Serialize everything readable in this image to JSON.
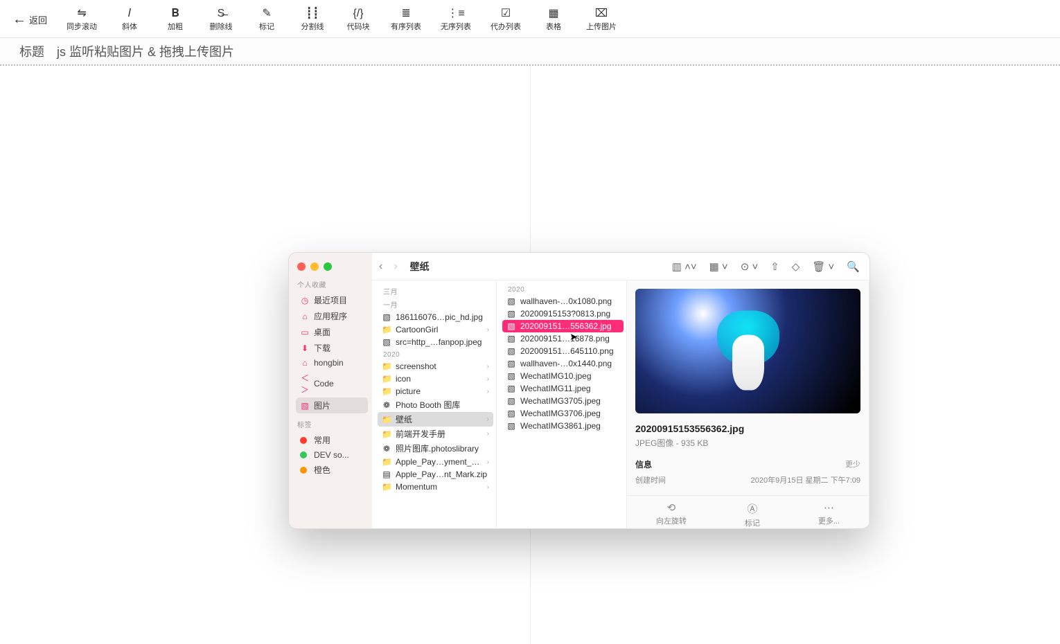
{
  "toolbar": {
    "back": "返回",
    "items": [
      {
        "icon": "⇋",
        "label": "同步滚动"
      },
      {
        "icon": "𝐼",
        "label": "斜体"
      },
      {
        "icon": "𝐁",
        "label": "加粗"
      },
      {
        "icon": "S̶",
        "label": "删除线"
      },
      {
        "icon": "✎",
        "label": "标记"
      },
      {
        "icon": "┋┋",
        "label": "分割线"
      },
      {
        "icon": "{/}",
        "label": "代码块"
      },
      {
        "icon": "≣",
        "label": "有序列表"
      },
      {
        "icon": "⋮≡",
        "label": "无序列表"
      },
      {
        "icon": "☑",
        "label": "代办列表"
      },
      {
        "icon": "▦",
        "label": "表格"
      },
      {
        "icon": "⌧",
        "label": "上传图片"
      }
    ]
  },
  "title": {
    "label": "标题",
    "value": "js 监听粘贴图片 & 拖拽上传图片"
  },
  "finder": {
    "title": "壁纸",
    "sections": {
      "fav": "个人收藏",
      "tags": "标签"
    },
    "sidebar": [
      {
        "icon": "◷",
        "label": "最近项目",
        "cls": "pink"
      },
      {
        "icon": "⌂",
        "label": "应用程序",
        "cls": "pink"
      },
      {
        "icon": "▭",
        "label": "桌面",
        "cls": "pink"
      },
      {
        "icon": "⬇",
        "label": "下载",
        "cls": "pink"
      },
      {
        "icon": "⌂",
        "label": "hongbin",
        "cls": "pink"
      },
      {
        "icon": "＜＞",
        "label": "Code",
        "cls": "pink"
      },
      {
        "icon": "▧",
        "label": "图片",
        "cls": "pink",
        "active": true
      }
    ],
    "tags": [
      {
        "color": "red",
        "label": "常用"
      },
      {
        "color": "green",
        "label": "DEV so..."
      },
      {
        "color": "orange",
        "label": "橙色"
      }
    ],
    "col1": {
      "groups": [
        {
          "title": "三月",
          "items": []
        },
        {
          "title": "一月",
          "items": [
            {
              "icon": "▧",
              "label": "186116076…pic_hd.jpg"
            },
            {
              "icon": "📁",
              "label": "CartoonGirl",
              "folder": true,
              "caret": true
            },
            {
              "icon": "▧",
              "label": "src=http_…fanpop.jpeg"
            }
          ]
        },
        {
          "title": "2020",
          "items": [
            {
              "icon": "📁",
              "label": "screenshot",
              "folder": true,
              "caret": true
            },
            {
              "icon": "📁",
              "label": "icon",
              "folder": true,
              "caret": true
            },
            {
              "icon": "📁",
              "label": "picture",
              "folder": true,
              "caret": true
            },
            {
              "icon": "❁",
              "label": "Photo Booth 图库",
              "iconcls": "red"
            },
            {
              "icon": "📁",
              "label": "壁纸",
              "folder": true,
              "caret": true,
              "selected": true
            },
            {
              "icon": "📁",
              "label": "前端开发手册",
              "folder": true,
              "caret": true
            },
            {
              "icon": "❁",
              "label": "照片图库.photoslibrary",
              "iconcls": "red"
            },
            {
              "icon": "📁",
              "label": "Apple_Pay…yment_Mark",
              "folder": true,
              "caret": true
            },
            {
              "icon": "▤",
              "label": "Apple_Pay…nt_Mark.zip"
            },
            {
              "icon": "📁",
              "label": "Momentum",
              "folder": true,
              "caret": true
            }
          ]
        }
      ]
    },
    "col2": {
      "title": "2020",
      "items": [
        {
          "label": "wallhaven-…0x1080.png"
        },
        {
          "label": "20200915153?0813.png"
        },
        {
          "label": "202009151…556362.jpg",
          "selected": true
        },
        {
          "label": "202009151…16878.png"
        },
        {
          "label": "202009151…645110.png"
        },
        {
          "label": "wallhaven-…0x1440.png"
        },
        {
          "label": "WechatIMG10.jpeg"
        },
        {
          "label": "WechatIMG11.jpeg"
        },
        {
          "label": "WechatIMG3705.jpeg"
        },
        {
          "label": "WechatIMG3706.jpeg"
        },
        {
          "label": "WechatIMG3861.jpeg"
        }
      ]
    },
    "preview": {
      "name": "20200915153556362.jpg",
      "meta": "JPEG图像 - 935 KB",
      "info_label": "信息",
      "more": "更少",
      "created_k": "创建时间",
      "created_v": "2020年9月15日 星期二 下午7:09"
    },
    "actions": [
      {
        "icon": "⟲",
        "label": "向左旋转"
      },
      {
        "icon": "Ⓐ",
        "label": "标记"
      },
      {
        "icon": "⋯",
        "label": "更多..."
      }
    ]
  }
}
